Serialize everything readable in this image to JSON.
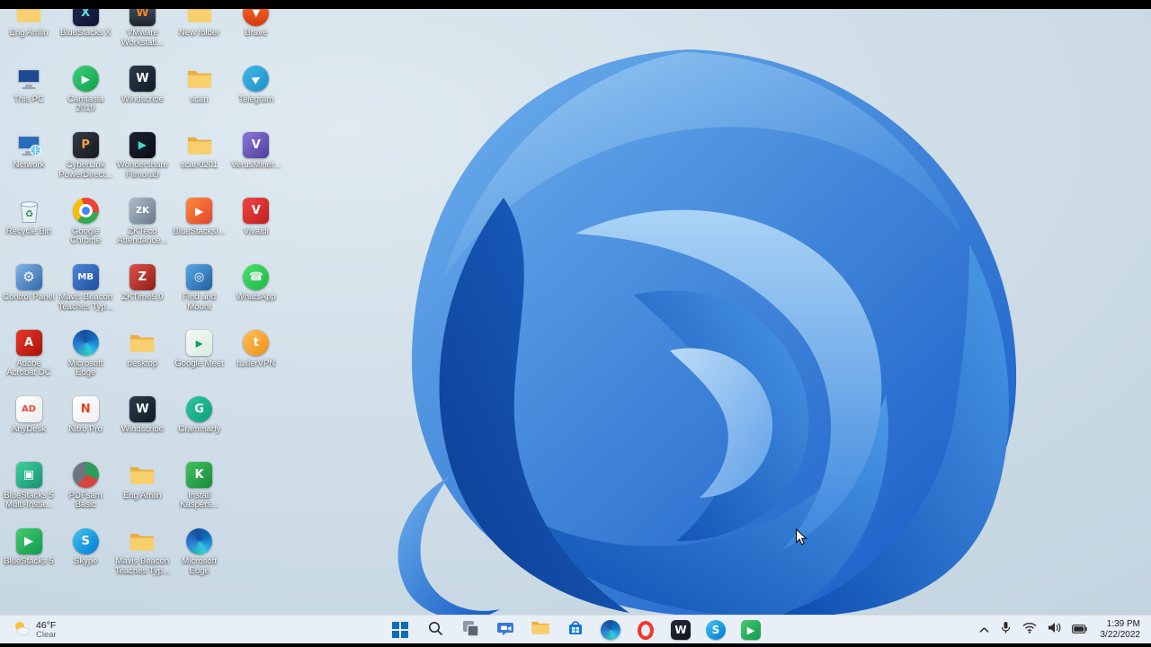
{
  "colors": {
    "taskbar_bg": "#e9eff7",
    "start_blue": "#0f6cbd",
    "desktop_label_text": "#ffffff",
    "tray_text": "#1b1b1b",
    "wallpaper_blues": [
      "#9ccdf4",
      "#5fa5ea",
      "#2e7ad6",
      "#1258c4",
      "#0a3d92"
    ]
  },
  "desktop": {
    "icons": [
      {
        "label": "Eng Amiin",
        "icon": "folder-icon",
        "kind": "folder",
        "col": 0,
        "row": 0
      },
      {
        "label": "This PC",
        "icon": "this-pc-icon",
        "kind": "pc",
        "col": 0,
        "row": 1
      },
      {
        "label": "Network",
        "icon": "network-icon",
        "kind": "network",
        "col": 0,
        "row": 2
      },
      {
        "label": "Recycle Bin",
        "icon": "recycle-bin-icon",
        "kind": "recycle",
        "col": 0,
        "row": 3
      },
      {
        "label": "Control Panel",
        "icon": "control-panel-icon",
        "kind": "app",
        "shape": "square",
        "bg": "linear-gradient(135deg,#7fb3e8,#3568a8)",
        "glyph": "⚙",
        "fg": "#ffffff",
        "fs": 15,
        "col": 0,
        "row": 4
      },
      {
        "label": "Adobe Acrobat DC",
        "icon": "adobe-acrobat-icon",
        "kind": "app",
        "shape": "square",
        "bg": "linear-gradient(135deg,#e8392b,#a8120a)",
        "glyph": "A",
        "fg": "#ffffff",
        "col": 0,
        "row": 5
      },
      {
        "label": "AnyDesk",
        "icon": "anydesk-icon",
        "kind": "app",
        "shape": "square",
        "bg": "linear-gradient(135deg,#ffffff,#ececec)",
        "glyph": "AD",
        "fg": "#ef443b",
        "fs": 10,
        "col": 0,
        "row": 6
      },
      {
        "label": "BlueStacks 5 Multi-Insta...",
        "icon": "bluestacks-multi-instance-icon",
        "kind": "app",
        "shape": "square",
        "bg": "linear-gradient(135deg,#43cfa0,#16926d)",
        "glyph": "▣",
        "fg": "#ffffff",
        "col": 0,
        "row": 7
      },
      {
        "label": "BlueStacks 5",
        "icon": "bluestacks5-icon",
        "kind": "app",
        "shape": "square",
        "bg": "linear-gradient(135deg,#49c96e,#0e9b4f)",
        "glyph": "▶",
        "fg": "#ffffff",
        "col": 0,
        "row": 8
      },
      {
        "label": "BlueStacks X",
        "icon": "bluestacks-x-icon",
        "kind": "app",
        "shape": "square",
        "bg": "linear-gradient(135deg,#232a52,#101430)",
        "glyph": "X",
        "fg": "#5fe0e6",
        "col": 1,
        "row": 0
      },
      {
        "label": "Camtasia 2019",
        "icon": "camtasia-icon",
        "kind": "app",
        "shape": "circle",
        "bg": "linear-gradient(135deg,#3ed17a,#0ca04e)",
        "glyph": "▶",
        "fg": "#ffffff",
        "fs": 12,
        "col": 1,
        "row": 1
      },
      {
        "label": "CyberLink PowerDirect...",
        "icon": "powerdirector-icon",
        "kind": "app",
        "shape": "square",
        "bg": "linear-gradient(135deg,#343b4a,#14181f)",
        "glyph": "P",
        "fg": "#f2a33c",
        "col": 1,
        "row": 2
      },
      {
        "label": "Google Chrome",
        "icon": "chrome-icon",
        "kind": "chrome",
        "col": 1,
        "row": 3
      },
      {
        "label": "Mavis Beacon Teaches Typ...",
        "icon": "mavis-beacon-icon",
        "kind": "app",
        "shape": "square",
        "bg": "linear-gradient(135deg,#4e86d8,#1d4f9c)",
        "glyph": "MB",
        "fg": "#ffffff",
        "fs": 10,
        "col": 1,
        "row": 4
      },
      {
        "label": "Microsoft Edge",
        "icon": "edge-icon",
        "kind": "edge",
        "col": 1,
        "row": 5
      },
      {
        "label": "Nitro Pro",
        "icon": "nitro-pro-icon",
        "kind": "app",
        "shape": "square",
        "bg": "linear-gradient(135deg,#ffffff,#efefef)",
        "glyph": "N",
        "fg": "#f0401c",
        "col": 1,
        "row": 6
      },
      {
        "label": "PDFsam Basic",
        "icon": "pdfsam-icon",
        "kind": "app",
        "shape": "circle",
        "bg": "conic-gradient(#2e9e5b 0 110deg,#d64541 110deg 220deg,#6b7682 220deg 360deg)",
        "glyph": "",
        "fg": "#ffffff",
        "col": 1,
        "row": 7
      },
      {
        "label": "Skype",
        "icon": "skype-icon",
        "kind": "app",
        "shape": "circle",
        "bg": "linear-gradient(135deg,#41c5f0,#0078d4)",
        "glyph": "S",
        "fg": "#ffffff",
        "col": 1,
        "row": 8
      },
      {
        "label": "VMware Workstati...",
        "icon": "vmware-workstation-icon",
        "kind": "app",
        "shape": "square",
        "bg": "linear-gradient(180deg,#49576a,#20262e)",
        "glyph": "W",
        "fg": "#f5821f",
        "col": 2,
        "row": 0
      },
      {
        "label": "Windscribe",
        "icon": "windscribe-icon",
        "kind": "app",
        "shape": "square",
        "bg": "linear-gradient(135deg,#2b3a4a,#101b26)",
        "glyph": "W",
        "fg": "#ffffff",
        "col": 2,
        "row": 1
      },
      {
        "label": "Wondershare Filmora9",
        "icon": "filmora-icon",
        "kind": "app",
        "shape": "square",
        "bg": "linear-gradient(135deg,#1c2030,#0b0e18)",
        "glyph": "▶",
        "fg": "#43d6c2",
        "fs": 12,
        "col": 2,
        "row": 2
      },
      {
        "label": "ZKTeco Attendance...",
        "icon": "zkteco-attendance-icon",
        "kind": "app",
        "shape": "square",
        "bg": "linear-gradient(135deg,#aebcca,#68798a)",
        "glyph": "ZK",
        "fg": "#ffffff",
        "fs": 10,
        "col": 2,
        "row": 3
      },
      {
        "label": "ZKTime5.0",
        "icon": "zktime-icon",
        "kind": "app",
        "shape": "square",
        "bg": "linear-gradient(135deg,#e05148,#8e1d16)",
        "glyph": "Z",
        "fg": "#ffffff",
        "col": 2,
        "row": 4
      },
      {
        "label": "desktop",
        "icon": "folder-icon",
        "kind": "folder",
        "col": 2,
        "row": 5
      },
      {
        "label": "Windscribe",
        "icon": "windscribe-icon",
        "kind": "app",
        "shape": "square",
        "bg": "linear-gradient(135deg,#2b3a4a,#101b26)",
        "glyph": "W",
        "fg": "#ffffff",
        "col": 2,
        "row": 6
      },
      {
        "label": "Eng Amiin",
        "icon": "folder-icon",
        "kind": "folder",
        "col": 2,
        "row": 7
      },
      {
        "label": "Mavis Beacon Teaches Typ...",
        "icon": "folder-icon",
        "kind": "folder",
        "col": 2,
        "row": 8
      },
      {
        "label": "New folder",
        "icon": "folder-icon",
        "kind": "folder",
        "col": 3,
        "row": 0
      },
      {
        "label": "scan",
        "icon": "folder-icon",
        "kind": "folder",
        "col": 3,
        "row": 1
      },
      {
        "label": "scan0201",
        "icon": "folder-icon",
        "kind": "folder",
        "col": 3,
        "row": 2
      },
      {
        "label": "BlueStacksI...",
        "icon": "bluestacks-installer-icon",
        "kind": "app",
        "shape": "square",
        "bg": "linear-gradient(135deg,#ff8a3c,#e2452e)",
        "glyph": "▶",
        "fg": "#ffffff",
        "fs": 12,
        "col": 3,
        "row": 3
      },
      {
        "label": "Find and Mount",
        "icon": "find-and-mount-icon",
        "kind": "app",
        "shape": "square",
        "bg": "linear-gradient(135deg,#5aa7e8,#215f9e)",
        "glyph": "◎",
        "fg": "#ffffff",
        "col": 3,
        "row": 4
      },
      {
        "label": "Google Meet",
        "icon": "google-meet-icon",
        "kind": "app",
        "shape": "square",
        "bg": "linear-gradient(135deg,#f4f9f6,#d9ece0)",
        "glyph": "▸",
        "fg": "#0f9d58",
        "fs": 16,
        "col": 3,
        "row": 5
      },
      {
        "label": "Grammarly",
        "icon": "grammarly-icon",
        "kind": "app",
        "shape": "circle",
        "bg": "linear-gradient(135deg,#2bc7a0,#0e9f7a)",
        "glyph": "G",
        "fg": "#ffffff",
        "col": 3,
        "row": 6
      },
      {
        "label": "Install Kaspers...",
        "icon": "kaspersky-installer-icon",
        "kind": "app",
        "shape": "square",
        "bg": "linear-gradient(135deg,#44c15f,#188a3a)",
        "glyph": "K",
        "fg": "#ffffff",
        "col": 3,
        "row": 7
      },
      {
        "label": "Microsoft Edge",
        "icon": "edge-icon",
        "kind": "edge",
        "col": 3,
        "row": 8
      },
      {
        "label": "Brave",
        "icon": "brave-icon",
        "kind": "app",
        "shape": "circle",
        "bg": "linear-gradient(180deg,#ff6b2b,#d33a10)",
        "glyph": "▼",
        "fg": "#ffffff",
        "fs": 11,
        "col": 4,
        "row": 0
      },
      {
        "label": "Telegram",
        "icon": "telegram-icon",
        "kind": "app",
        "shape": "circle",
        "bg": "linear-gradient(135deg,#41b7e8,#1d90c9)",
        "glyph": "▶",
        "fg": "#ffffff",
        "fs": 11,
        "rotate": -30,
        "col": 4,
        "row": 1
      },
      {
        "label": "VerusMiner...",
        "icon": "verusminer-icon",
        "kind": "app",
        "shape": "square",
        "bg": "linear-gradient(135deg,#8a77d6,#4f3da0)",
        "glyph": "V",
        "fg": "#ffffff",
        "col": 4,
        "row": 2
      },
      {
        "label": "Vivaldi",
        "icon": "vivaldi-icon",
        "kind": "app",
        "shape": "square",
        "bg": "linear-gradient(135deg,#f04545,#bf1f1f)",
        "glyph": "V",
        "fg": "#ffffff",
        "col": 4,
        "row": 3
      },
      {
        "label": "WhatsApp",
        "icon": "whatsapp-icon",
        "kind": "app",
        "shape": "circle",
        "bg": "linear-gradient(135deg,#4ae26a,#1cb748)",
        "glyph": "☎",
        "fg": "#ffffff",
        "fs": 13,
        "col": 4,
        "row": 4
      },
      {
        "label": "tuxlerVPN",
        "icon": "tuxlervpn-icon",
        "kind": "app",
        "shape": "circle",
        "bg": "linear-gradient(135deg,#ffc05c,#ef8d12)",
        "glyph": "t",
        "fg": "#ffffff",
        "col": 4,
        "row": 5
      }
    ]
  },
  "taskbar": {
    "weather": {
      "temp": "46°F",
      "condition": "Clear"
    },
    "buttons": [
      {
        "name": "start",
        "icon": "windows-start-icon"
      },
      {
        "name": "search",
        "icon": "search-icon"
      },
      {
        "name": "task-view",
        "icon": "task-view-icon"
      },
      {
        "name": "chat",
        "icon": "chat-icon"
      },
      {
        "name": "file-explorer",
        "icon": "file-explorer-icon"
      },
      {
        "name": "microsoft-store",
        "icon": "microsoft-store-icon"
      },
      {
        "name": "microsoft-edge",
        "icon": "edge-icon"
      },
      {
        "name": "opera",
        "icon": "opera-icon"
      },
      {
        "name": "filmora",
        "icon": "filmora-w-icon",
        "glyph": "W"
      },
      {
        "name": "skype",
        "icon": "skype-icon",
        "glyph": "S"
      },
      {
        "name": "bluestacks",
        "icon": "bluestacks-icon",
        "glyph": "▶"
      }
    ],
    "tray_icons": [
      {
        "name": "hidden-icons",
        "icon": "chevron-up-icon"
      },
      {
        "name": "microphone",
        "icon": "microphone-icon"
      },
      {
        "name": "network",
        "icon": "wifi-icon"
      },
      {
        "name": "volume",
        "icon": "speaker-icon"
      },
      {
        "name": "battery",
        "icon": "battery-icon"
      }
    ],
    "clock": {
      "time": "1:39 PM",
      "date": "3/22/2022"
    }
  }
}
